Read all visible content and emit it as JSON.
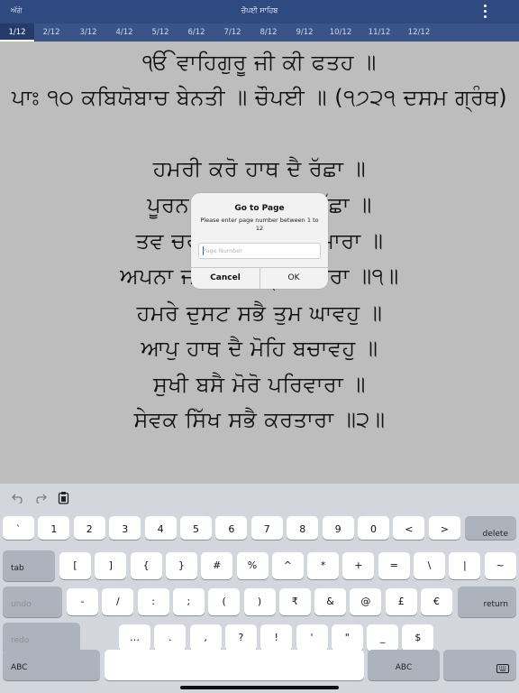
{
  "topbar": {
    "back_label": "ਅੱਗੇ",
    "title": "ਚੌਪਈ ਸਾਹਿਬ",
    "menu_icon": "more-vertical-icon"
  },
  "tabs": [
    {
      "label": "1/12",
      "active": true
    },
    {
      "label": "2/12"
    },
    {
      "label": "3/12"
    },
    {
      "label": "4/12"
    },
    {
      "label": "5/12"
    },
    {
      "label": "6/12"
    },
    {
      "label": "7/12"
    },
    {
      "label": "8/12"
    },
    {
      "label": "9/12"
    },
    {
      "label": "10/12"
    },
    {
      "label": "11/12"
    },
    {
      "label": "12/12"
    }
  ],
  "content": {
    "lines": [
      "ੴ ਵਾਹਿਗੁਰੂ ਜੀ ਕੀ ਫਤਹ ॥",
      "ਪਾਃ ੧੦ ਕਬਿਯੋਬਾਚ ਬੇਨਤੀ ॥ ਚੌਪਈ ॥ (੧੭੨੧ ਦਸਮ ਗ੍ਰੰਥ)",
      "ਹਮਰੀ ਕਰੋ ਹਾਥ ਦੈ ਰੱਛਾ ॥",
      "ਪੂਰਨ ਹੋਇ ਚਿੱਤ ਕੀ ਇੱਛਾ ॥",
      "ਤਵ ਚਰਨਨ ਮਨ ਰਹੈ ਹਮਾਰਾ ॥",
      "ਅਪਨਾ ਜਾਨ ਕਰੋ ਪ੍ਰਤਿਪਾਰਾ ॥੧॥",
      "ਹਮਰੇ ਦੁਸਟ ਸਭੈ ਤੁਮ ਘਾਵਹੁ ॥",
      "ਆਪੁ ਹਾਥ ਦੈ ਮੋਹਿ ਬਚਾਵਹੁ ॥",
      "ਸੁਖੀ ਬਸੈ ਮੋਰੋ ਪਰਿਵਾਰਾ ॥",
      "ਸੇਵਕ ਸਿੱਖ ਸਭੈ ਕਰਤਾਰਾ ॥੨॥"
    ]
  },
  "dialog": {
    "title": "Go to Page",
    "message": "Please enter page number between 1 to 12",
    "input_placeholder": "Page Number",
    "input_value": "",
    "cancel_label": "Cancel",
    "ok_label": "OK"
  },
  "keyboard": {
    "tools": {
      "undo_icon": "undo-icon",
      "redo_icon": "redo-icon",
      "paste_icon": "clipboard-icon"
    },
    "row1": [
      "`",
      "1",
      "2",
      "3",
      "4",
      "5",
      "6",
      "7",
      "8",
      "9",
      "0",
      "<",
      ">"
    ],
    "row1_end": "delete",
    "row2_start": "tab",
    "row2": [
      "[",
      "]",
      "{",
      "}",
      "#",
      "%",
      "^",
      "*",
      "+",
      "=",
      "\\",
      "|",
      "~"
    ],
    "row3_start": "undo",
    "row3": [
      "-",
      "/",
      ":",
      ";",
      "(",
      ")",
      "₹",
      "&",
      "@",
      "£",
      "€"
    ],
    "row3_end": "return",
    "row4_start": "redo",
    "row4": [
      "…",
      ".",
      ",",
      "?",
      "!",
      "'",
      "\"",
      "_",
      "$"
    ],
    "row5_left": "ABC",
    "row5_right": "ABC",
    "keyboard_icon": "keyboard-dismiss-icon"
  },
  "colors": {
    "header": "#2f4a80",
    "tabs": "#3a5489",
    "content_bg": "#bdbdbd",
    "keyboard_bg": "#d3d6dc",
    "caret": "#2a6fdb"
  }
}
